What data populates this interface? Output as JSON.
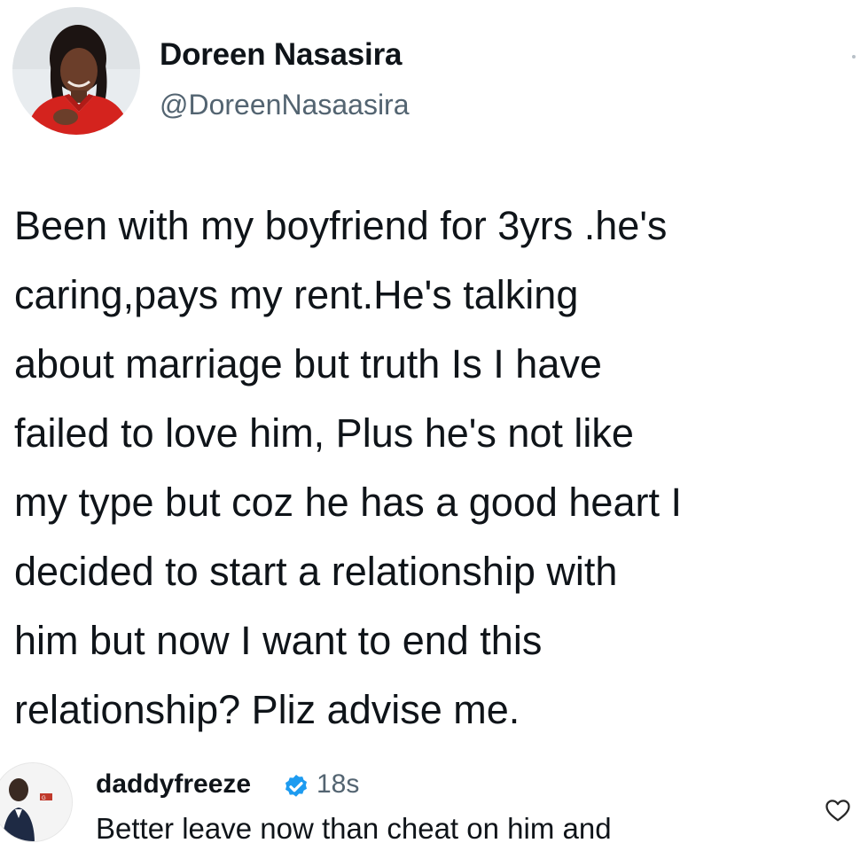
{
  "tweet": {
    "author_name": "Doreen Nasasira",
    "author_handle": "@DoreenNasaasira",
    "avatar_icon": "profile-photo-woman-red-top",
    "more_icon": "more-dots-icon",
    "lines": [
      "Been with my boyfriend for 3yrs .he's",
      "caring,pays my rent.He's talking",
      "about marriage but truth Is I have",
      "failed to love him, Plus he's not like",
      "my type but coz he has a good heart I",
      "decided to start a relationship with",
      "him but now I want to end this",
      "relationship? Pliz advise me."
    ]
  },
  "comment": {
    "username": "daddyfreeze",
    "verified_icon": "verified-badge-icon",
    "time": "18s",
    "text": "Better leave now than cheat on him and",
    "like_icon": "heart-outline-icon"
  },
  "colors": {
    "text": "#0f1419",
    "secondary_text": "#536471",
    "verified": "#1d9bf0",
    "background": "#ffffff"
  }
}
